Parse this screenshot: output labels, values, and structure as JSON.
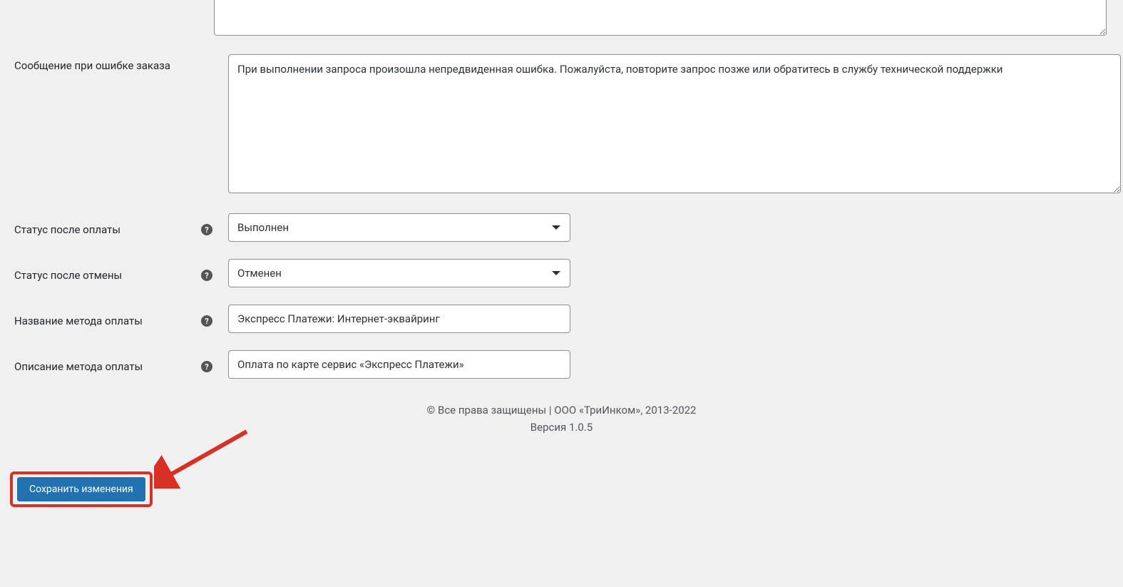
{
  "form": {
    "top_textarea_value": "",
    "error_message": {
      "label": "Сообщение при ошибке заказа",
      "value": "При выполнении запроса произошла непредвиденная ошибка. Пожалуйста, повторите запрос позже или обратитесь в службу технической поддержки"
    },
    "status_after_payment": {
      "label": "Статус после оплаты",
      "value": "Выполнен"
    },
    "status_after_cancel": {
      "label": "Статус после отмены",
      "value": "Отменен"
    },
    "payment_method_name": {
      "label": "Название метода оплаты",
      "value": "Экспресс Платежи: Интернет-эквайринг"
    },
    "payment_method_description": {
      "label": "Описание метода оплаты",
      "value": "Оплата по карте сервис «Экспресс Платежи»"
    }
  },
  "footer": {
    "copyright": "© Все права защищены | ООО «ТриИнком», 2013-2022",
    "version": "Версия 1.0.5"
  },
  "buttons": {
    "save": "Сохранить изменения"
  },
  "help_symbol": "?"
}
